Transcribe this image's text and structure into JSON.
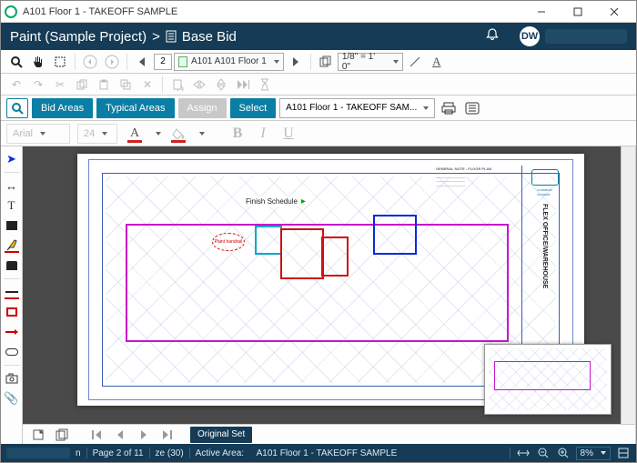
{
  "window": {
    "title": "A101 Floor 1 - TAKEOFF SAMPLE"
  },
  "header": {
    "project": "Paint (Sample Project)",
    "sep": ">",
    "section": "Base Bid",
    "avatar": "DW"
  },
  "nav": {
    "page_no": "2",
    "plan": "A101 A101 Floor 1",
    "scale": "1/8\" = 1' 0\""
  },
  "tabs": {
    "bid_areas": "Bid Areas",
    "typical_areas": "Typical Areas",
    "assign": "Assign",
    "select": "Select",
    "area_dd": "A101 Floor 1 - TAKEOFF SAM..."
  },
  "font": {
    "family": "Arial",
    "size": "24"
  },
  "plan": {
    "finish_label": "Finish Schedule",
    "cloud_note": "Paint handrail",
    "title_vert": "FLEX OFFICE/WAREHOUSE",
    "notes_heading": "GENERAL NOTE - FLOOR PLAN"
  },
  "bottom": {
    "set_label": "Original Set"
  },
  "status": {
    "hidden_suffix": "n",
    "page": "Page 2 of 11",
    "ze": "ze (30)",
    "active_label": "Active Area:",
    "active_value": "A101 Floor 1 - TAKEOFF SAMPLE",
    "zoom": "8%"
  }
}
